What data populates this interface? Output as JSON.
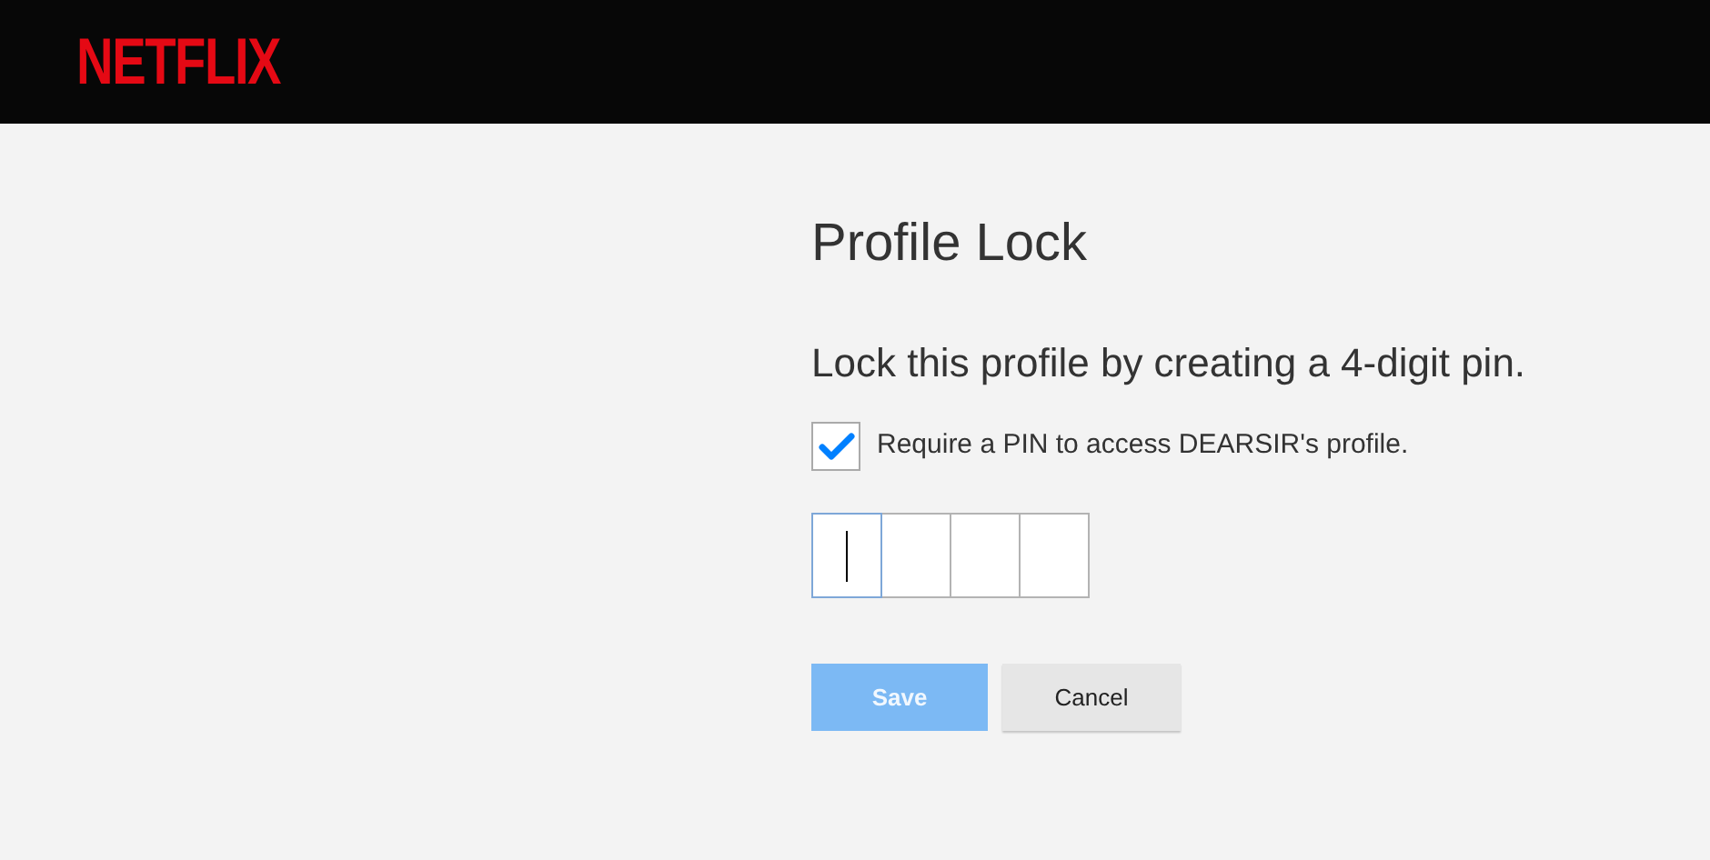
{
  "header": {
    "logo": "NETFLIX"
  },
  "title": "Profile Lock",
  "subtitle": "Lock this profile by creating a 4-digit pin.",
  "require_pin": {
    "label": "Require a PIN to access DEARSIR's profile.",
    "checked": true
  },
  "pin_boxes": [
    {
      "focused": true
    },
    {
      "focused": false
    },
    {
      "focused": false
    },
    {
      "focused": false
    }
  ],
  "buttons": [
    {
      "kind": "primary",
      "label": "Save",
      "disabled": true
    },
    {
      "kind": "secondary",
      "label": "Cancel",
      "disabled": false
    }
  ]
}
